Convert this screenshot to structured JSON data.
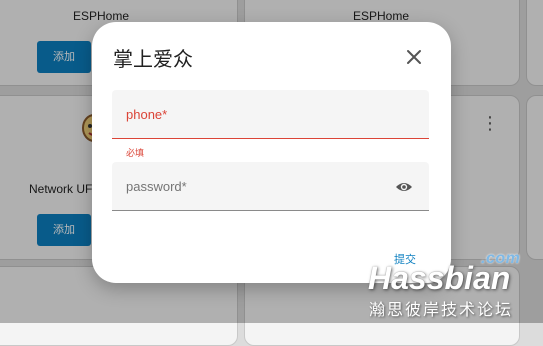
{
  "background_cards": [
    {
      "title": "ESPHome",
      "button_label": "添加"
    },
    {
      "title": "ESPHome"
    },
    {
      "title": "Network UF",
      "button_label": "添加"
    }
  ],
  "dialog": {
    "title": "掌上爱众",
    "phone_label": "phone*",
    "phone_helper": "必填",
    "password_label": "password*",
    "submit_label": "提交"
  },
  "watermark": {
    "main": "Hassbian",
    "com": ".com",
    "sub": "瀚思彼岸技术论坛"
  },
  "colors": {
    "accent": "#0c7fc0",
    "error": "#db4437",
    "overlay": "rgba(0,0,0,0.28)"
  }
}
